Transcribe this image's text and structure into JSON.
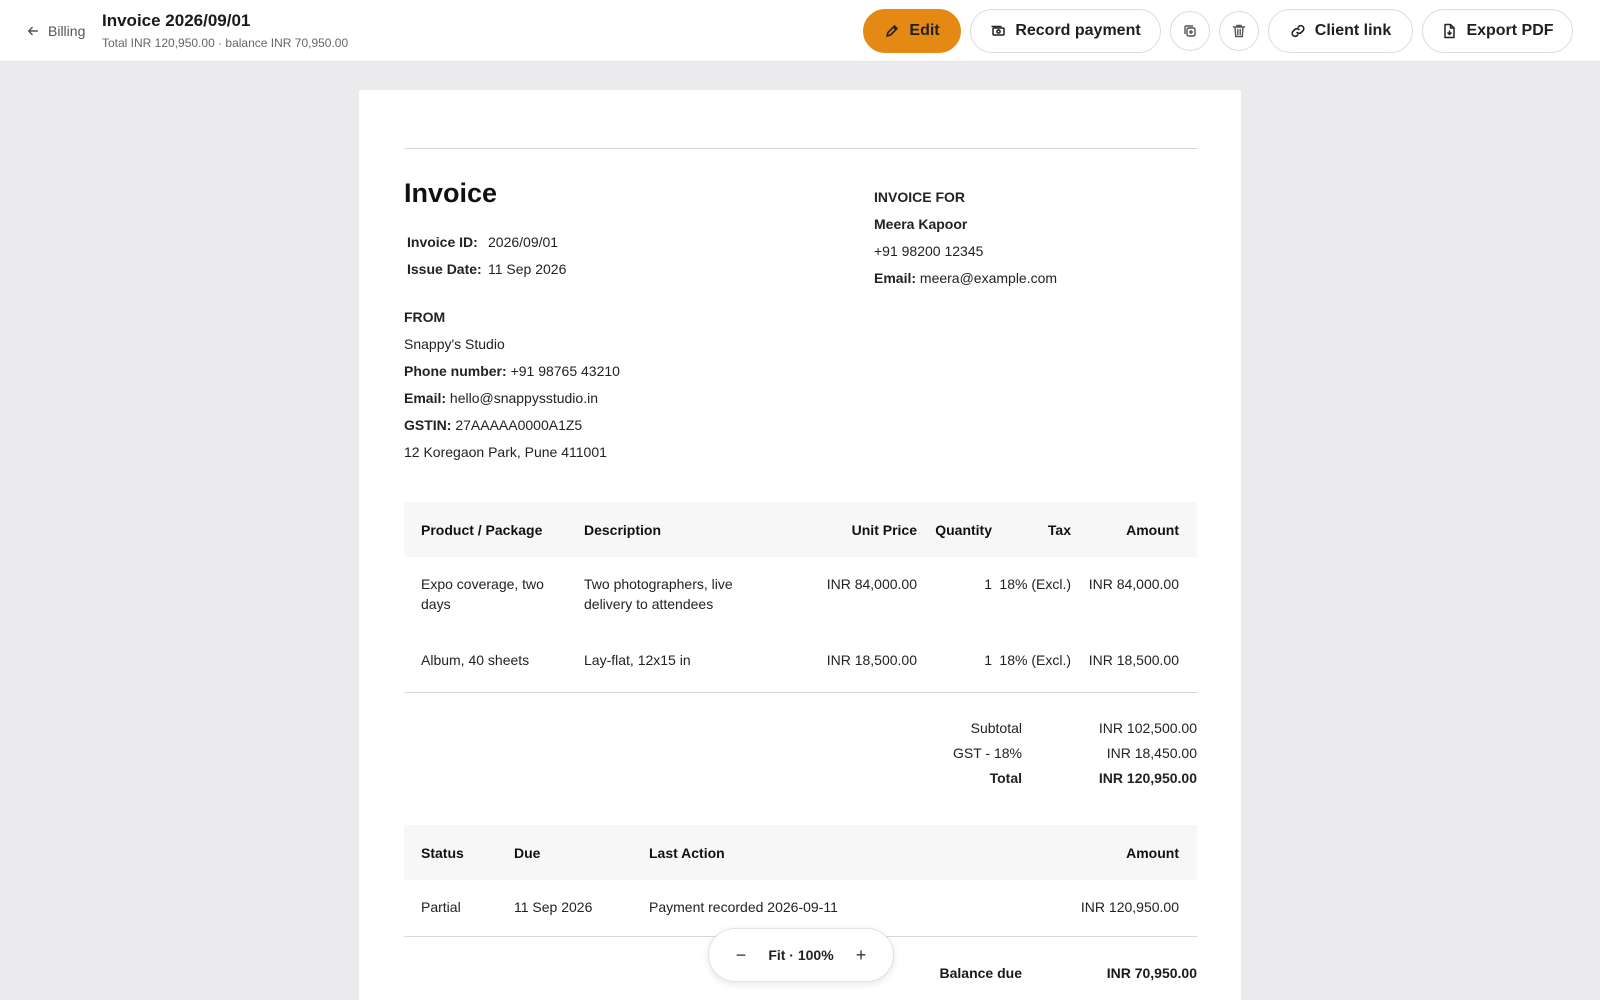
{
  "header": {
    "back_label": "Billing",
    "title": "Invoice 2026/09/01",
    "subtitle": "Total INR 120,950.00 · balance INR 70,950.00"
  },
  "toolbar": {
    "edit_label": "Edit",
    "record_payment_label": "Record payment",
    "client_link_label": "Client link",
    "export_pdf_label": "Export PDF"
  },
  "invoice": {
    "heading": "Invoice",
    "id_label": "Invoice ID:",
    "id_value": "2026/09/01",
    "date_label": "Issue Date:",
    "date_value": "11 Sep 2026",
    "from": {
      "heading": "FROM",
      "name": "Snappy's Studio",
      "phone_label": "Phone number:",
      "phone": "+91 98765 43210",
      "email_label": "Email:",
      "email": "hello@snappysstudio.in",
      "gstin_label": "GSTIN:",
      "gstin": "27AAAAA0000A1Z5",
      "address": "12 Koregaon Park, Pune 411001"
    },
    "for": {
      "heading": "INVOICE FOR",
      "name": "Meera Kapoor",
      "phone": "+91 98200 12345",
      "email_label": "Email:",
      "email": "meera@example.com"
    },
    "items_columns": [
      "Product / Package",
      "Description",
      "Unit Price",
      "Quantity",
      "Tax",
      "Amount"
    ],
    "items": [
      {
        "product_l1": "Expo coverage, two",
        "product_l2": "days",
        "description_l1": "Two photographers, live",
        "description_l2": "delivery to attendees",
        "unit_price": "INR 84,000.00",
        "quantity": "1",
        "tax": "18% (Excl.)",
        "amount": "INR 84,000.00"
      },
      {
        "product": "Album, 40 sheets",
        "description": "Lay-flat, 12x15 in",
        "unit_price": "INR 18,500.00",
        "quantity": "1",
        "tax": "18% (Excl.)",
        "amount": "INR 18,500.00"
      }
    ],
    "totals": {
      "subtotal_label": "Subtotal",
      "subtotal": "INR 102,500.00",
      "gst_label": "GST - 18%",
      "gst": "INR 18,450.00",
      "total_label": "Total",
      "total": "INR 120,950.00"
    },
    "status_columns": [
      "Status",
      "Due",
      "Last Action",
      "Amount"
    ],
    "status_row": {
      "status": "Partial",
      "due": "11 Sep 2026",
      "last_action": "Payment recorded 2026-09-11",
      "amount": "INR 120,950.00"
    },
    "balance_label": "Balance due",
    "balance": "INR 70,950.00"
  },
  "zoom": {
    "minus": "−",
    "label": "Fit · 100%",
    "plus": "+"
  },
  "colors": {
    "accent": "#e48a14",
    "canvas": "#ebebed"
  },
  "icons": [
    "arrow-left-icon",
    "pencil-icon",
    "money-icon",
    "duplicate-icon",
    "trash-icon",
    "link-icon",
    "pdf-file-icon"
  ]
}
